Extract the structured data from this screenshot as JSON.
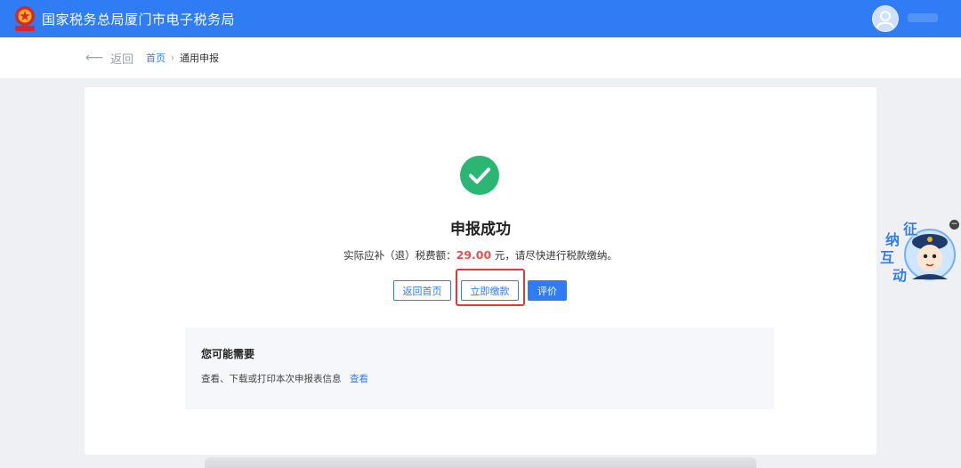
{
  "header": {
    "title": "国家税务总局厦门市电子税务局",
    "emblem_icon": "national-emblem-icon",
    "avatar_icon": "user-avatar-icon"
  },
  "nav": {
    "back_label": "返回",
    "breadcrumb": {
      "home": "首页",
      "separator": "›",
      "current": "通用申报"
    }
  },
  "result": {
    "icon": "success-check-icon",
    "title": "申报成功",
    "desc_prefix": "实际应补（退）税费额：",
    "amount": "29.00",
    "desc_suffix": " 元，请尽快进行税款缴纳。"
  },
  "actions": {
    "home_label": "返回首页",
    "pay_label": "立即缴款",
    "rate_label": "评价"
  },
  "needs": {
    "title": "您可能需要",
    "text": "查看、下载或打印本次申报表信息",
    "link": "查看"
  },
  "widget": {
    "chars": [
      "征",
      "纳",
      "互",
      "动"
    ],
    "close_symbol": "−"
  },
  "colors": {
    "brand": "#2f7cf4",
    "success": "#2bb673",
    "amount": "#e94f4f",
    "highlight": "#e53935"
  }
}
